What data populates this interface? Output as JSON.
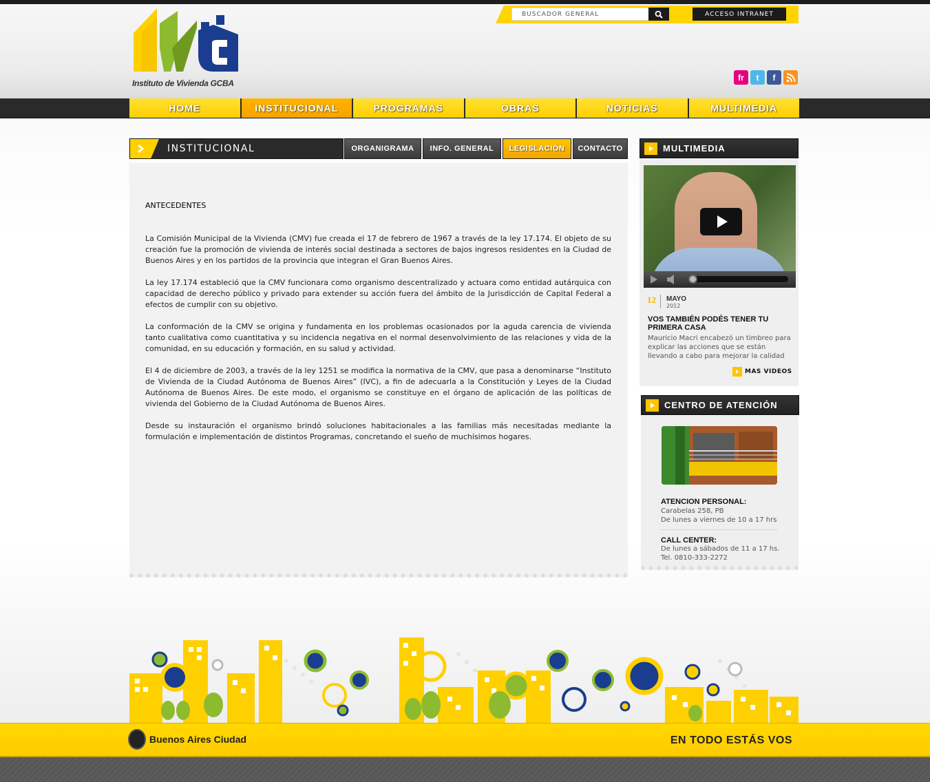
{
  "header": {
    "logo_text": "IVC",
    "logo_caption": "Instituto de Vivienda GCBA",
    "search_placeholder": "BUSCADOR GENERAL",
    "intranet_label": "ACCESO INTRANET",
    "social": [
      {
        "name": "flickr",
        "glyph": "fr",
        "color": "#e6007e"
      },
      {
        "name": "twitter",
        "glyph": "t",
        "color": "#4fb8e8"
      },
      {
        "name": "facebook",
        "glyph": "f",
        "color": "#3b5998"
      },
      {
        "name": "rss",
        "glyph": "~",
        "color": "#f7931e"
      }
    ]
  },
  "nav": {
    "items": [
      "HOME",
      "INSTITUCIONAL",
      "PROGRAMAS",
      "OBRAS",
      "NOTICIAS",
      "MULTIMEDIA"
    ],
    "active": "INSTITUCIONAL"
  },
  "section": {
    "title": "INSTITUCIONAL",
    "tabs": [
      "ORGANIGRAMA",
      "INFO. GENERAL",
      "LEGISLACIÓN",
      "CONTACTO"
    ],
    "active_tab": "LEGISLACIÓN"
  },
  "content": {
    "heading": "ANTECEDENTES",
    "paragraphs": [
      "La Comisión Municipal de la Vivienda (CMV) fue creada el 17 de febrero de 1967 a través de la ley 17.174. El objeto de su creación fue la promoción de vivienda de interés social destinada a sectores de bajos ingresos residentes en la Ciudad de Buenos Aires y en los partidos de la provincia que integran el Gran Buenos Aires.",
      "La ley 17.174 estableció que la CMV funcionara como organismo descentralizado y actuara como entidad autárquica con capacidad de derecho público y privado para extender su acción fuera del ámbito de la Jurisdicción de Capital Federal a efectos de cumplir con su objetivo.",
      "La conformación de la CMV se origina y fundamenta en los problemas ocasionados por la aguda carencia de vivienda tanto cualitativa como cuantitativa y su incidencia negativa en el normal desenvolvimiento de las relaciones y vida de la comunidad, en su educación y formación, en su salud y actividad.",
      "El 4 de diciembre de 2003, a través de la ley 1251 se modifica la normativa de la CMV, que pasa a denominarse “Instituto de Vivienda de la Ciudad Autónoma de Buenos Aires” (IVC), a fin de adecuarla a la Constitución y Leyes de la Ciudad Autónoma de Buenos Aires. De este modo, el organismo se constituye en el órgano de aplicación de las políticas de vivienda del Gobierno de la Ciudad Autónoma de Buenos Aires.",
      "Desde su instauración el organismo brindó soluciones habitacionales a las familias más necesitadas mediante la formulación e implementación de distintos Programas, concretando el sueño de muchísimos hogares."
    ]
  },
  "multimedia": {
    "title": "MULTIMEDIA",
    "day": "12",
    "month": "MAYO",
    "year": "2012",
    "news_title": "VOS TAMBIÉN PODÉS TENER TU PRIMERA CASA",
    "excerpt": "Mauricio Macri encabezó un timbreo para explicar las acciones que se están llevando a cabo para mejorar la calidad de",
    "more_label": "MAS VIDEOS"
  },
  "centro": {
    "title": "CENTRO DE ATENCIÓN",
    "personal_label": "ATENCION PERSONAL:",
    "personal_address": "Carabelas 258, PB",
    "personal_hours": "De lunes a viernes de 10 a 17 hrs",
    "call_label": "CALL CENTER:",
    "call_hours": "De lunes a sábados de 11 a 17 hs.",
    "call_phone": "Tel. 0810-333-2272"
  },
  "footer": {
    "ba_label": "Buenos Aires Ciudad",
    "slogan": "EN TODO ESTÁS VOS"
  },
  "colors": {
    "accent_yellow": "#ffd000",
    "accent_orange": "#f7a300",
    "dark": "#2a2a2a"
  }
}
